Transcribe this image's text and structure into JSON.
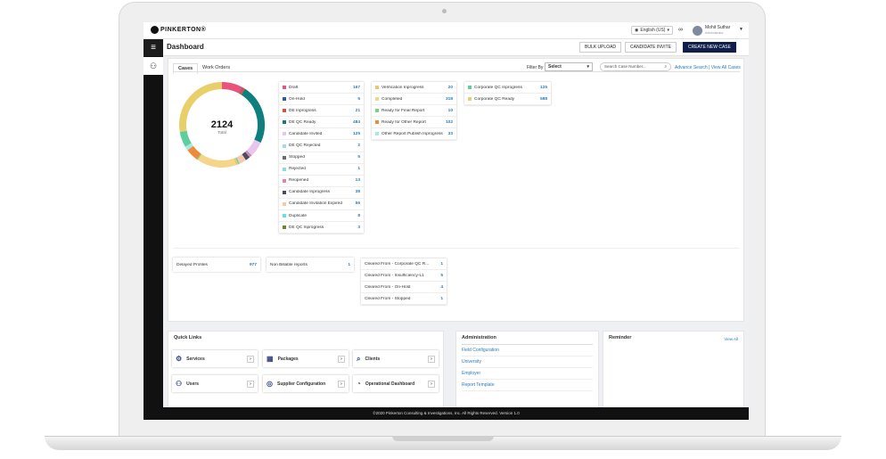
{
  "app": {
    "logo": "PINKERTON®"
  },
  "topbar": {
    "language": "English (US)",
    "user_name": "Mohit Suthar",
    "user_role": "Administrator"
  },
  "header": {
    "title": "Dashboard",
    "bulk_upload": "BULK UPLOAD",
    "candidate_invite": "CANDIDATE INVITE",
    "create_case": "CREATE NEW CASE"
  },
  "tabs": [
    "Cases",
    "Work Orders"
  ],
  "filter": {
    "label": "Filter By",
    "selected": "Select",
    "search_placeholder": "Search Case Number...",
    "advance": "Advance Search",
    "view_all": "View All Cases"
  },
  "donut": {
    "total": "2124",
    "total_label": "Total"
  },
  "status_col1": [
    {
      "label": "Draft",
      "value": "167",
      "color": "#e8547a"
    },
    {
      "label": "On-Hold",
      "value": "5",
      "color": "#2a5caa"
    },
    {
      "label": "DE Inprogress",
      "value": "21",
      "color": "#e14d3c"
    },
    {
      "label": "DE QC Ready",
      "value": "484",
      "color": "#0f7e7e"
    },
    {
      "label": "Candidate Invited",
      "value": "125",
      "color": "#e9c4ef"
    },
    {
      "label": "DE QC Rejected",
      "value": "2",
      "color": "#a9d8ee"
    },
    {
      "label": "Stopped",
      "value": "5",
      "color": "#6b6b6b"
    },
    {
      "label": "Rejected",
      "value": "1",
      "color": "#85e0d6"
    },
    {
      "label": "Reopened",
      "value": "13",
      "color": "#f07bb0"
    },
    {
      "label": "Candidate Inprogress",
      "value": "38",
      "color": "#4a4a6a"
    },
    {
      "label": "Candidate Invitation Expired",
      "value": "56",
      "color": "#f7c9a8"
    },
    {
      "label": "Duplicate",
      "value": "8",
      "color": "#5fe3e3"
    },
    {
      "label": "DE QC Inprogress",
      "value": "3",
      "color": "#6a8a1e"
    }
  ],
  "status_col2": [
    {
      "label": "Verification Inprogress",
      "value": "20",
      "color": "#e8c86a"
    },
    {
      "label": "Completed",
      "value": "318",
      "color": "#f5d58a"
    },
    {
      "label": "Ready for Final Report",
      "value": "10",
      "color": "#7fd07f"
    },
    {
      "label": "Ready for Other Report",
      "value": "102",
      "color": "#ef8a3a"
    },
    {
      "label": "Other Report Publish Inprogress",
      "value": "33",
      "color": "#a8e8e2"
    }
  ],
  "status_col3": [
    {
      "label": "Corporate QC Inprogress",
      "value": "125",
      "color": "#5ccf9a"
    },
    {
      "label": "Corporate QC Ready",
      "value": "588",
      "color": "#e9cf6a"
    }
  ],
  "misc": {
    "delayed_label": "Delayed Profiles",
    "delayed_value": "977",
    "nonbill_label": "Non Billable reports",
    "nonbill_value": "1"
  },
  "cleared": [
    {
      "label": "Cleared From - Corporate QC R...",
      "value": "1"
    },
    {
      "label": "Cleared From - Insufficiency-L1",
      "value": "5"
    },
    {
      "label": "Cleared From - On-Hold",
      "value": "4"
    },
    {
      "label": "Cleared From - Stopped",
      "value": "1"
    }
  ],
  "quick_links": {
    "title": "Quick Links",
    "items": [
      "Services",
      "Packages",
      "Clients",
      "Users",
      "Supplier Configuration",
      "Operational Dashboard"
    ]
  },
  "administration": {
    "title": "Administration",
    "items": [
      "Field Configuration",
      "University",
      "Employer",
      "Report Template"
    ]
  },
  "reminder": {
    "title": "Reminder",
    "view_all": "View All"
  },
  "footer": "©2020 Pinkerton Consulting & Investigations, Inc. All Rights Reserved. Version 1.0"
}
